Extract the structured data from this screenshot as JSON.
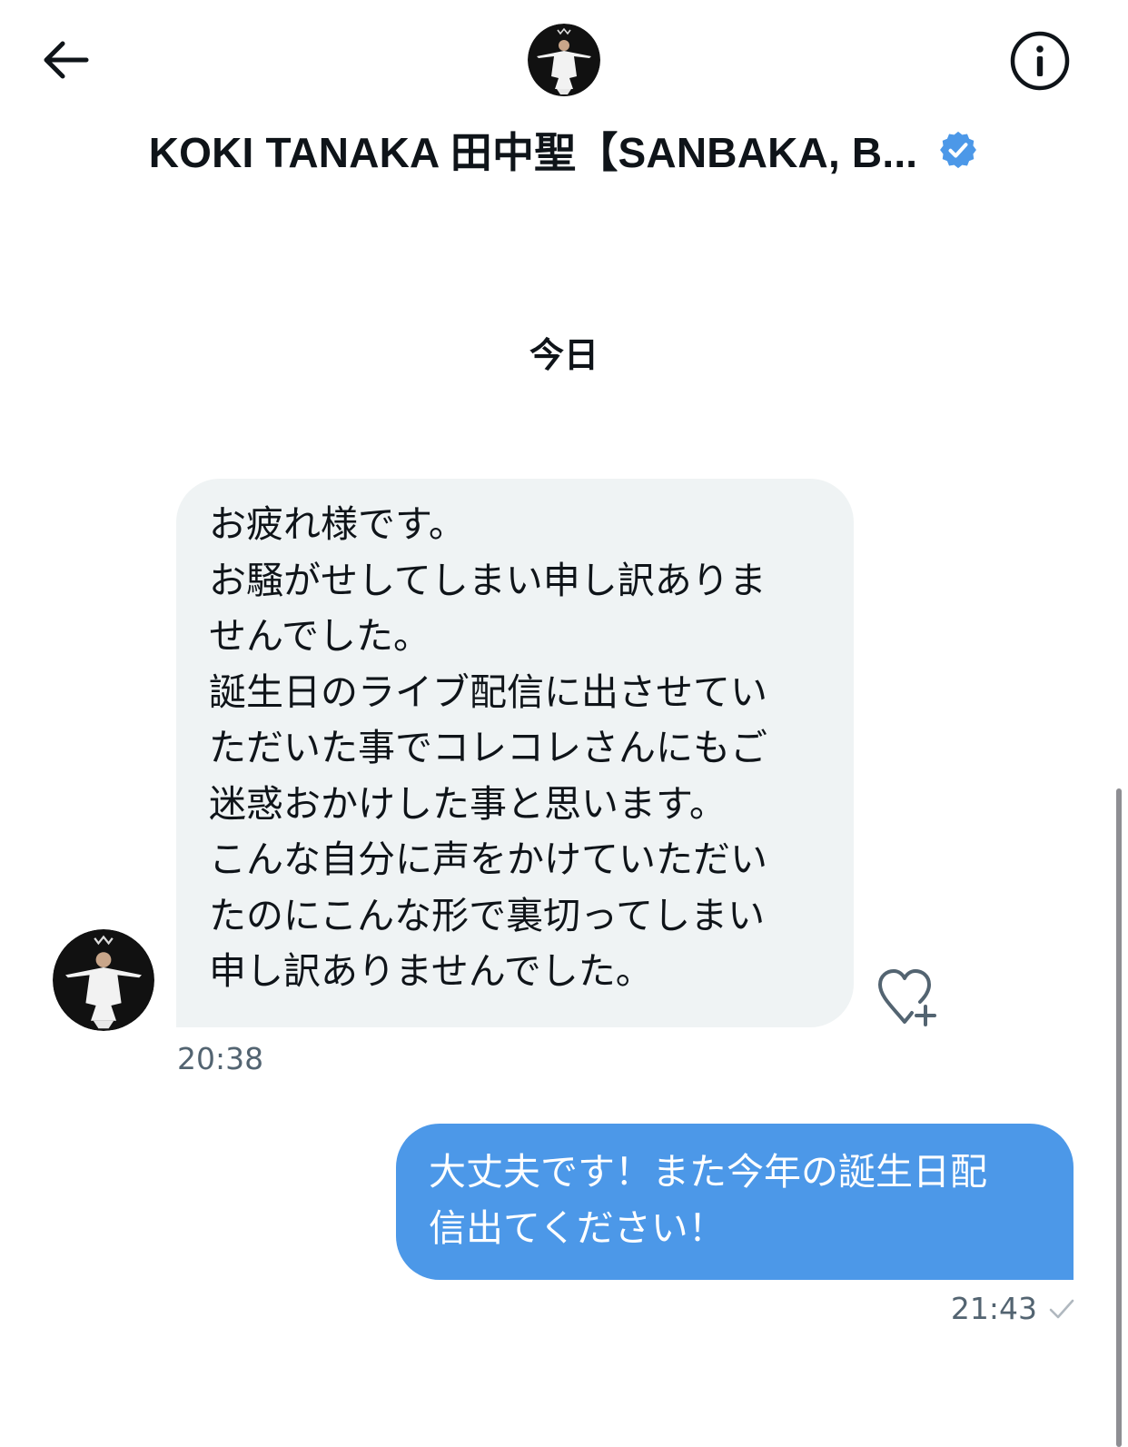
{
  "header": {
    "back_icon": "arrow-left-icon",
    "avatar_icon": "user-avatar",
    "title": "KOKI TANAKA 田中聖【SANBAKA, B...",
    "verified_icon": "verified-badge-icon",
    "verified_color": "#4c98e8",
    "info_icon": "info-icon"
  },
  "conversation": {
    "date_separator": "今日",
    "messages": [
      {
        "direction": "received",
        "text": "お疲れ様です。\nお騒がせしてしまい申し訳ありま\nせんでした。\n誕生日のライブ配信に出させてい\nただいた事でコレコレさんにもご\n迷惑おかけした事と思います。\nこんな自分に声をかけていただい\nたのにこんな形で裏切ってしまい\n申し訳ありませんでした。",
        "time": "20:38",
        "reaction_icon": "heart-plus-icon"
      },
      {
        "direction": "sent",
        "text": "大丈夫です！また今年の誕生日配\n信出てください！",
        "time": "21:43",
        "status_icon": "sent-check-icon"
      }
    ]
  },
  "colors": {
    "received_bubble": "#eff3f4",
    "sent_bubble": "#4c98e8",
    "timestamp": "#536471"
  }
}
